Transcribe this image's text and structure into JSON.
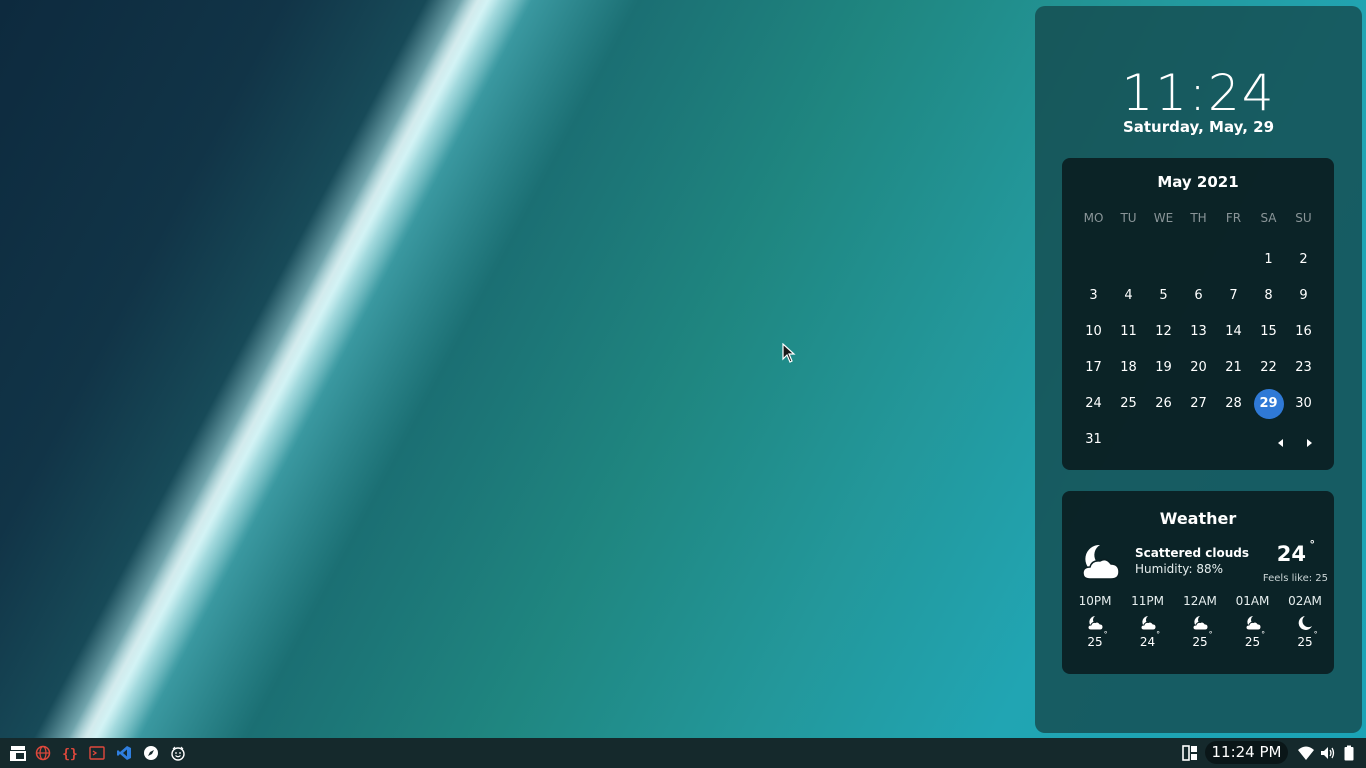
{
  "panel": {
    "time": "11:24",
    "date": "Saturday, May, 29"
  },
  "calendar": {
    "title": "May 2021",
    "weekdays": [
      "MO",
      "TU",
      "WE",
      "TH",
      "FR",
      "SA",
      "SU"
    ],
    "days": [
      "1",
      "2",
      "3",
      "4",
      "5",
      "6",
      "7",
      "8",
      "9",
      "10",
      "11",
      "12",
      "13",
      "14",
      "15",
      "16",
      "17",
      "18",
      "19",
      "20",
      "21",
      "22",
      "23",
      "24",
      "25",
      "26",
      "27",
      "28",
      "29",
      "30",
      "31"
    ],
    "today": "29",
    "today_color": "#2f79d6"
  },
  "weather": {
    "title": "Weather",
    "condition": "Scattered clouds",
    "humidity": "Humidity: 88%",
    "temperature": "24",
    "degree": "°",
    "feels_like": "Feels like: 25",
    "icon": "night-cloud-icon",
    "hourly": [
      {
        "time": "10PM",
        "temp": "25",
        "icon": "night-cloud-icon"
      },
      {
        "time": "11PM",
        "temp": "24",
        "icon": "night-cloud-icon"
      },
      {
        "time": "12AM",
        "temp": "25",
        "icon": "night-cloud-icon"
      },
      {
        "time": "01AM",
        "temp": "25",
        "icon": "night-cloud-icon"
      },
      {
        "time": "02AM",
        "temp": "25",
        "icon": "moon-icon"
      }
    ]
  },
  "taskbar": {
    "launchers": [
      "app-menu-icon",
      "browser-icon",
      "code-editor-icon",
      "terminal-icon",
      "vscode-icon",
      "compass-icon",
      "smiley-icon"
    ],
    "clock": "11:24 PM",
    "tray": [
      "grid-icon",
      "wifi-icon",
      "volume-icon",
      "battery-icon"
    ],
    "accent": "#e0483c"
  }
}
